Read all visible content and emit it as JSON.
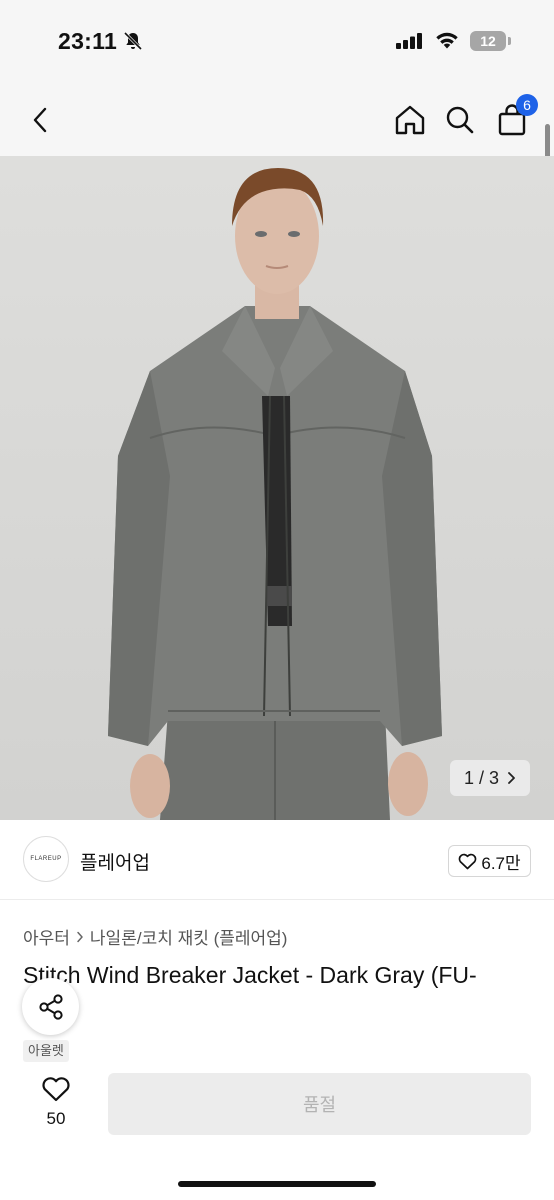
{
  "status": {
    "time": "23:11",
    "battery": "12",
    "icons": [
      "bell-slash-icon",
      "signal-icon",
      "wifi-icon",
      "battery-icon"
    ]
  },
  "nav": {
    "back_icon": "chevron-left-icon",
    "home_icon": "home-icon",
    "search_icon": "search-icon",
    "cart_icon": "shopping-bag-icon",
    "cart_count": "6"
  },
  "image": {
    "counter": "1 / 3",
    "next_icon": "chevron-right-icon"
  },
  "shop": {
    "logo_text": "FLAREUP",
    "name": "플레어업",
    "likes": "6.7만"
  },
  "breadcrumb": {
    "category": "아우터",
    "subcategory": "나일론/코치 재킷 (플레어업)"
  },
  "product": {
    "title": "Stitch Wind Breaker Jacket - Dark Gray (FU-",
    "tag": "아울렛"
  },
  "bottom": {
    "wish_count": "50",
    "action_label": "품절"
  },
  "colors": {
    "badge": "#1e62e8",
    "disabled_button": "#ececec",
    "disabled_text": "#b3b3b3"
  }
}
